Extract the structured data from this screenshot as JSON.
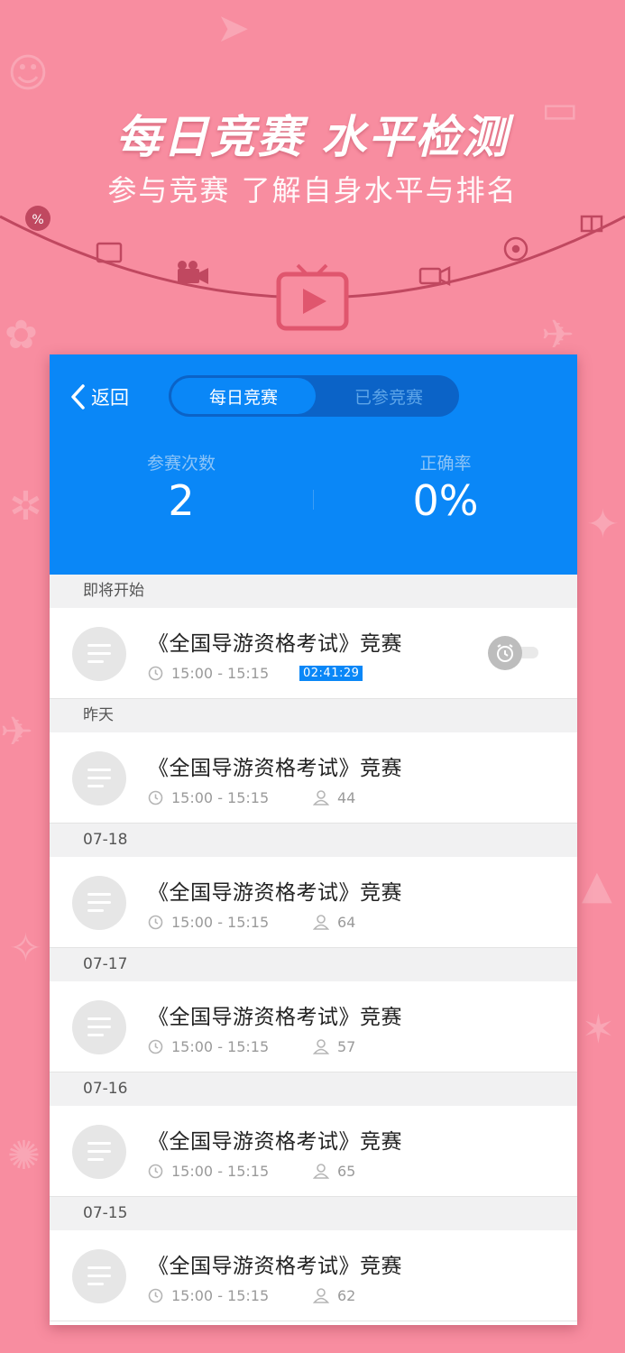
{
  "promo": {
    "title": "每日竞赛 水平检测",
    "subtitle": "参与竞赛 了解自身水平与排名"
  },
  "header": {
    "back_label": "返回",
    "tabs": [
      {
        "label": "每日竞赛",
        "active": true
      },
      {
        "label": "已参竞赛",
        "active": false
      }
    ]
  },
  "stats": [
    {
      "label": "参赛次数",
      "value": "2"
    },
    {
      "label": "正确率",
      "value": "0%"
    }
  ],
  "sections": [
    {
      "header": "即将开始",
      "item": {
        "title": "《全国导游资格考试》竞赛",
        "time": "15:00 - 15:15",
        "countdown": "02:41:29",
        "reminder_on": false
      }
    },
    {
      "header": "昨天",
      "item": {
        "title": "《全国导游资格考试》竞赛",
        "time": "15:00 - 15:15",
        "participants": "44"
      }
    },
    {
      "header": "07-18",
      "item": {
        "title": "《全国导游资格考试》竞赛",
        "time": "15:00 - 15:15",
        "participants": "64"
      }
    },
    {
      "header": "07-17",
      "item": {
        "title": "《全国导游资格考试》竞赛",
        "time": "15:00 - 15:15",
        "participants": "57"
      }
    },
    {
      "header": "07-16",
      "item": {
        "title": "《全国导游资格考试》竞赛",
        "time": "15:00 - 15:15",
        "participants": "65"
      }
    },
    {
      "header": "07-15",
      "item": {
        "title": "《全国导游资格考试》竞赛",
        "time": "15:00 - 15:15",
        "participants": "62"
      }
    }
  ],
  "colors": {
    "background": "#f88da0",
    "header_blue": "#0a87f7",
    "countdown_bg": "#0a87f7",
    "tv_icon": "#e0566e"
  },
  "icons": [
    "tv-play-icon",
    "back-chevron-icon",
    "clock-icon",
    "person-icon",
    "alarm-icon",
    "list-icon"
  ]
}
